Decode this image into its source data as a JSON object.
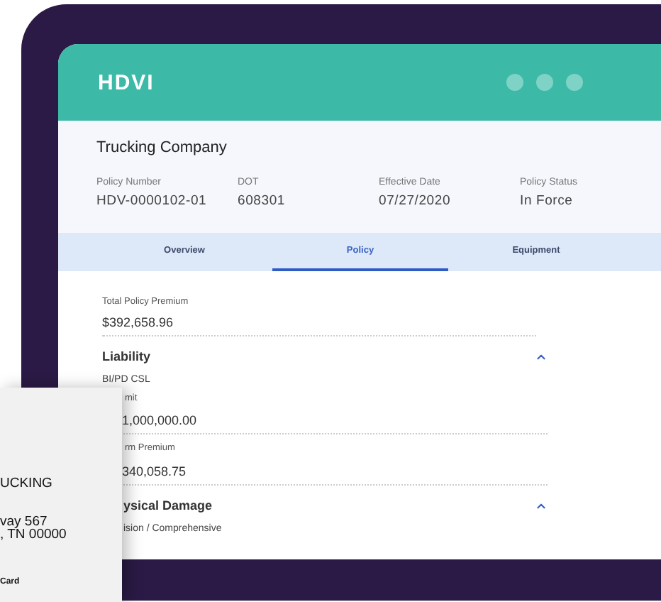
{
  "app": {
    "logo": "HDVI"
  },
  "policy": {
    "company": "Trucking Company",
    "fields": [
      {
        "label": "Policy Number",
        "value": "HDV-0000102-01"
      },
      {
        "label": "DOT",
        "value": "608301"
      },
      {
        "label": "Effective Date",
        "value": "07/27/2020"
      },
      {
        "label": "Policy Status",
        "value": "In Force"
      }
    ]
  },
  "tabs": [
    {
      "label": "Overview",
      "selected": false
    },
    {
      "label": "Policy",
      "selected": true
    },
    {
      "label": "Equipment",
      "selected": false
    }
  ],
  "content": {
    "total": {
      "label": "Total Policy Premium",
      "value": "$392,658.96"
    },
    "sections": [
      {
        "title": "Liability",
        "covered": false,
        "expanded": true,
        "subtitle": "BI/PD CSL",
        "items": [
          {
            "label": "mit",
            "value": "1,000,000.00",
            "covered": true
          },
          {
            "label": "rm Premium",
            "value": "340,058.75",
            "covered": true
          }
        ]
      },
      {
        "title": "ysical Damage",
        "covered": true,
        "expanded": true,
        "subtitle": "ision / Comprehensive"
      }
    ]
  },
  "card": {
    "lines": [
      {
        "kind": "name",
        "text": "UCKING"
      },
      {
        "kind": "address",
        "text": "vay 567"
      },
      {
        "kind": "address",
        "text": ", TN 00000"
      },
      {
        "kind": "caption",
        "text": "Card"
      }
    ]
  }
}
